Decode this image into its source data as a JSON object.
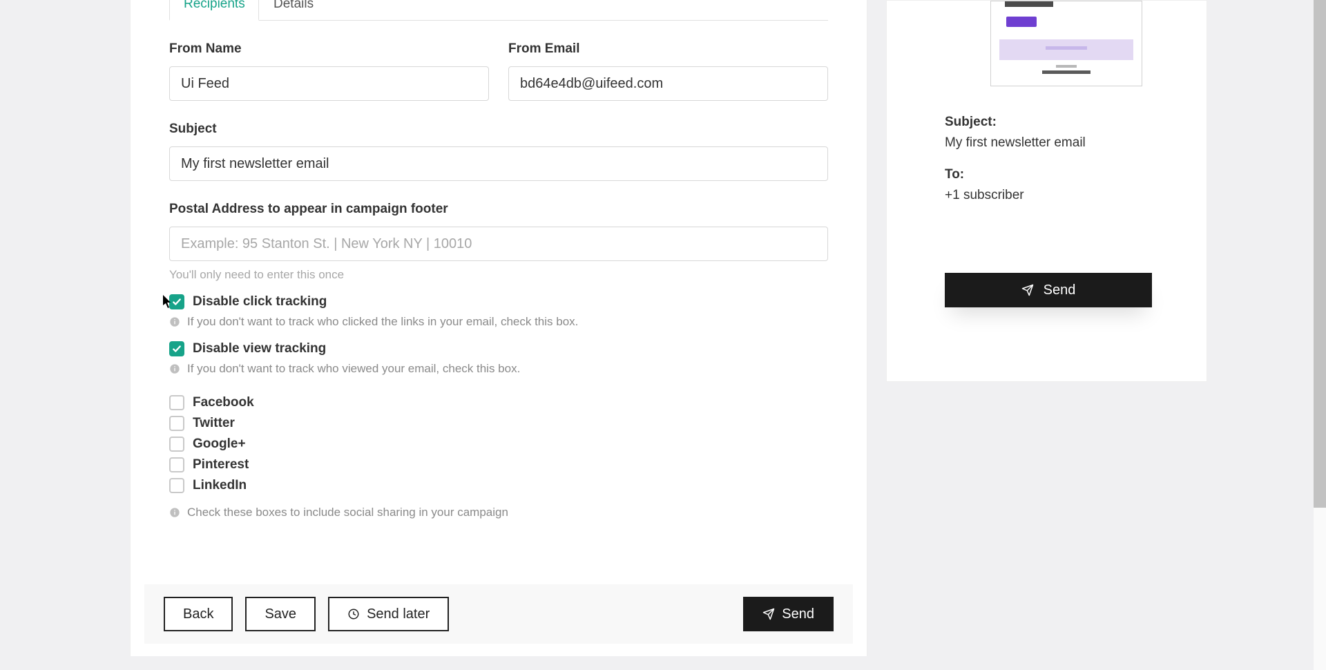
{
  "tabs": {
    "recipients": "Recipients",
    "details": "Details"
  },
  "form": {
    "from_name_label": "From Name",
    "from_name_value": "Ui Feed",
    "from_email_label": "From Email",
    "from_email_value": "bd64e4db@uifeed.com",
    "subject_label": "Subject",
    "subject_value": "My first newsletter email",
    "postal_label": "Postal Address to appear in campaign footer",
    "postal_placeholder": "Example: 95 Stanton St. | New York NY | 10010",
    "postal_helper": "You'll only need to enter this once",
    "disable_click_label": "Disable click tracking",
    "disable_click_help": "If you don't want to track who clicked the links in your email, check this box.",
    "disable_view_label": "Disable view tracking",
    "disable_view_help": "If you don't want to track who viewed your email, check this box.",
    "social": {
      "facebook": "Facebook",
      "twitter": "Twitter",
      "googleplus": "Google+",
      "pinterest": "Pinterest",
      "linkedin": "LinkedIn",
      "helper": "Check these boxes to include social sharing in your campaign"
    }
  },
  "footer": {
    "back": "Back",
    "save": "Save",
    "send_later": "Send later",
    "send": "Send"
  },
  "summary": {
    "subject_label": "Subject:",
    "subject_value": "My first newsletter email",
    "to_label": "To:",
    "to_value": "+1 subscriber",
    "send": "Send"
  }
}
